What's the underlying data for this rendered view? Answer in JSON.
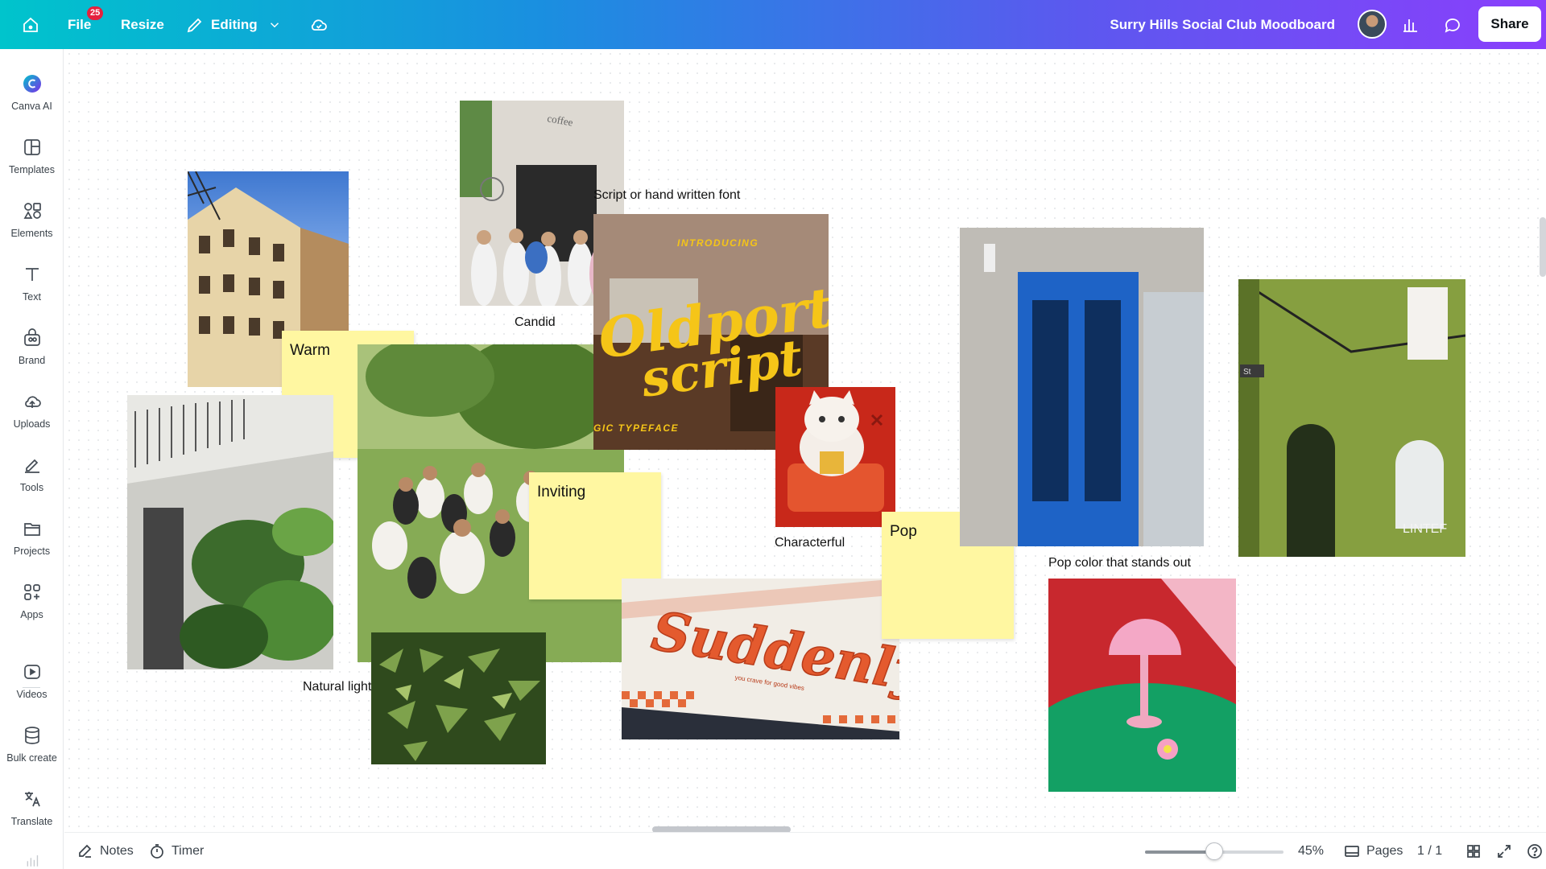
{
  "topbar": {
    "file_label": "File",
    "file_badge": "25",
    "resize_label": "Resize",
    "editing_label": "Editing",
    "doc_title": "Surry Hills Social Club Moodboard",
    "share_label": "Share"
  },
  "sidebar": {
    "items": [
      {
        "label": "Canva AI",
        "icon": "canva-ai-icon"
      },
      {
        "label": "Templates",
        "icon": "templates-icon"
      },
      {
        "label": "Elements",
        "icon": "elements-icon"
      },
      {
        "label": "Text",
        "icon": "text-icon"
      },
      {
        "label": "Brand",
        "icon": "brand-icon"
      },
      {
        "label": "Uploads",
        "icon": "uploads-icon"
      },
      {
        "label": "Tools",
        "icon": "tools-icon"
      },
      {
        "label": "Projects",
        "icon": "projects-icon"
      },
      {
        "label": "Apps",
        "icon": "apps-icon"
      },
      {
        "label": "Videos",
        "icon": "videos-icon"
      },
      {
        "label": "Bulk create",
        "icon": "bulk-create-icon"
      },
      {
        "label": "Translate",
        "icon": "translate-icon"
      }
    ]
  },
  "canvas": {
    "stickies": {
      "warm": "Warm",
      "inviting": "Inviting",
      "pop": "Pop"
    },
    "captions": {
      "candid": "Candid",
      "script_font": "Script or hand written font",
      "characterful": "Characterful",
      "natural_lighting": "Natural lighting",
      "pop_color": "Pop color that stands out"
    },
    "photo_text": {
      "coffee_sign": "coffee",
      "introducing": "INTRODUCING",
      "oldport": "Oldport",
      "script": "script",
      "typeface": "GIC TYPEFACE",
      "suddenly": "Suddenly",
      "suddenly_tag": "you crave for good vibes",
      "street_sign": "St",
      "linter": "LINTEF"
    }
  },
  "bottombar": {
    "notes_label": "Notes",
    "timer_label": "Timer",
    "zoom_level": "45%",
    "zoom_fraction": 0.5,
    "pages_label": "Pages",
    "page_indicator": "1 / 1"
  }
}
